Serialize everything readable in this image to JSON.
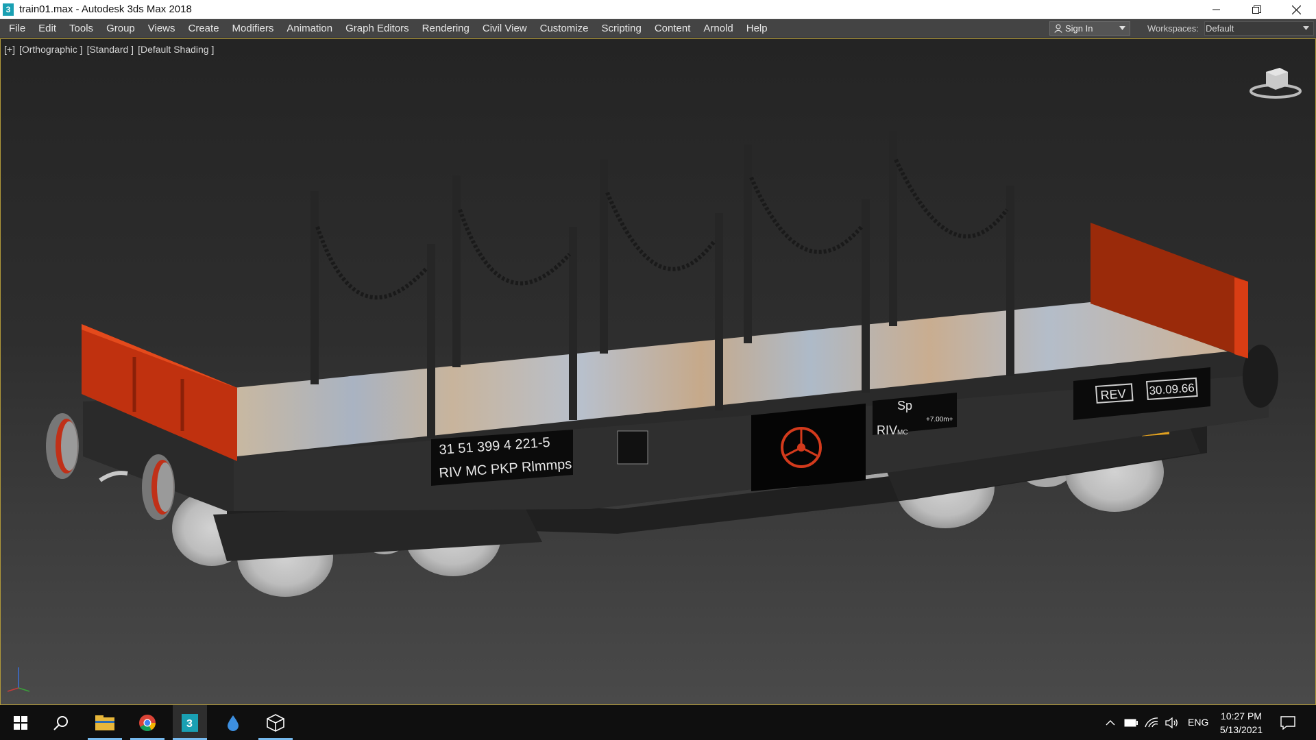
{
  "window": {
    "title": "train01.max - Autodesk 3ds Max 2018",
    "app_icon_glyph": "3"
  },
  "menubar": {
    "items": [
      "File",
      "Edit",
      "Tools",
      "Group",
      "Views",
      "Create",
      "Modifiers",
      "Animation",
      "Graph Editors",
      "Rendering",
      "Civil View",
      "Customize",
      "Scripting",
      "Content",
      "Arnold",
      "Help"
    ],
    "signin_label": "Sign In",
    "workspaces_label": "Workspaces:",
    "workspace_value": "Default"
  },
  "viewport": {
    "labels": [
      "[+]",
      "[Orthographic ]",
      "[Standard ]",
      "[Default Shading ]"
    ],
    "model": {
      "car_number": "31 51 399 4 221-5",
      "car_marking": "RIV MC PKP Rlmmps",
      "rev_label": "REV",
      "rev_date": "30.09.66",
      "sp_label": "Sp",
      "riv_label": "RIV",
      "mc_label": "MC",
      "height_label": "+7.00m+"
    }
  },
  "taskbar": {
    "language": "ENG",
    "time": "10:27 PM",
    "date": "5/13/2021"
  },
  "colors": {
    "menubar_bg": "#444444",
    "viewport_border": "#b29a3a",
    "stake_color": "#262626",
    "end_wall_red": "#c0310f",
    "taskbar_bg": "#0f0f0f",
    "taskbar_accent": "#76b9ed"
  },
  "icons": [
    "app-3dsmax-icon",
    "minimize-icon",
    "restore-icon",
    "close-icon",
    "person-icon",
    "chevron-down-icon",
    "viewcube-icon",
    "axis-tripod-icon",
    "windows-start-icon",
    "search-icon",
    "file-explorer-icon",
    "chrome-icon",
    "3dsmax-icon",
    "water-drop-icon",
    "cube-outline-icon",
    "chevron-up-icon",
    "battery-icon",
    "wifi-icon",
    "volume-icon",
    "notification-icon"
  ]
}
